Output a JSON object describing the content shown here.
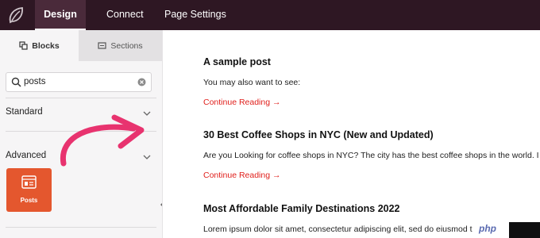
{
  "topbar": {
    "tabs": [
      "Design",
      "Connect",
      "Page Settings"
    ]
  },
  "sidebar": {
    "tabs": [
      "Blocks",
      "Sections"
    ],
    "search": {
      "value": "posts"
    },
    "sections": [
      "Standard",
      "Advanced"
    ],
    "blocks": [
      {
        "label": "Posts",
        "icon": "posts-grid-icon"
      }
    ]
  },
  "main": {
    "posts": [
      {
        "title": "A sample post",
        "text": "You may also want to see:",
        "link": "Continue Reading →"
      },
      {
        "title": "30 Best Coffee Shops in NYC (New and Updated)",
        "text": "Are you Looking for coffee shops in NYC? The city has the best coffee shops in the world. I",
        "link": "Continue Reading →"
      },
      {
        "title": "Most Affordable Family Destinations 2022",
        "text": "Lorem ipsum dolor sit amet, consectetur adipiscing elit, sed do eiusmod t"
      }
    ]
  },
  "watermark": {
    "text": "php"
  },
  "colors": {
    "topbar": "#2e1723",
    "accent": "#e4572e",
    "link": "#e0201c",
    "arrow": "#e8336f"
  }
}
